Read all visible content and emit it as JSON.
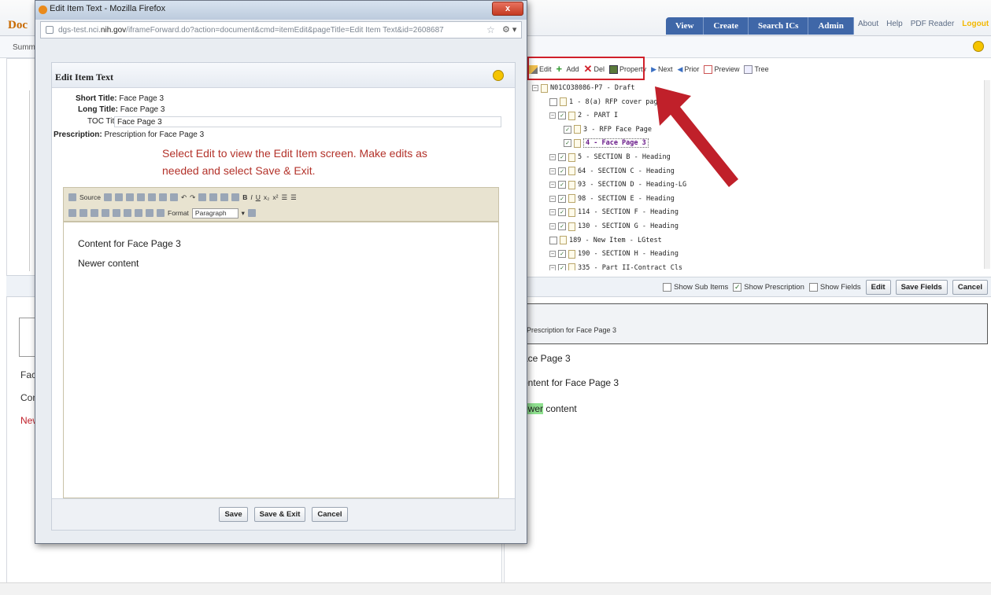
{
  "app": {
    "logo": "Doc",
    "nav_tabs": [
      "View",
      "Create",
      "Search ICs",
      "Admin"
    ],
    "nav_links": [
      "About",
      "Help",
      "PDF Reader"
    ],
    "logout": "Logout",
    "sub_summary": "Summ"
  },
  "right_toolbar": {
    "items": [
      "Edit",
      "Add",
      "Del",
      "Property",
      "Next",
      "Prior",
      "Preview",
      "Tree"
    ]
  },
  "tree": {
    "root": "N01CO38086-P7 - Draft",
    "items": [
      {
        "label": "1 - 8(a) RFP cover page",
        "checked": false,
        "expandable": false
      },
      {
        "label": "2 - PART I",
        "checked": true,
        "expandable": true
      },
      {
        "label": "3 - RFP Face Page",
        "checked": true,
        "expandable": false
      },
      {
        "label": "4 - Face Page 3",
        "checked": true,
        "expandable": false,
        "selected": true
      },
      {
        "label": "5 - SECTION B - Heading",
        "checked": true,
        "expandable": true
      },
      {
        "label": "64 - SECTION C - Heading",
        "checked": true,
        "expandable": true
      },
      {
        "label": "93 - SECTION D - Heading-LG",
        "checked": true,
        "expandable": true
      },
      {
        "label": "98 - SECTION E - Heading",
        "checked": true,
        "expandable": true
      },
      {
        "label": "114 - SECTION F - Heading",
        "checked": true,
        "expandable": true
      },
      {
        "label": "130 - SECTION G - Heading",
        "checked": true,
        "expandable": true
      },
      {
        "label": "189 - New Item - LGtest",
        "checked": false,
        "expandable": false
      },
      {
        "label": "190 - SECTION H - Heading",
        "checked": true,
        "expandable": true
      },
      {
        "label": "335 - Part II-Contract Cls",
        "checked": true,
        "expandable": true
      }
    ]
  },
  "options_bar": {
    "show_sub_items": "Show Sub Items",
    "show_prescription": "Show Prescription",
    "show_fields": "Show Fields",
    "edit": "Edit",
    "save_fields": "Save Fields",
    "cancel": "Cancel",
    "show_prescription_checked": true
  },
  "right_preview": {
    "prescription": "Prescription for Face Page 3",
    "title": "ace Page 3",
    "content": "ontent for Face Page 3",
    "newer_highlight": "ewer",
    "newer_rest": " content"
  },
  "left_preview": {
    "line1": "Fac",
    "line2": "Con",
    "line3": "New"
  },
  "modal": {
    "window_title": "Edit Item Text - Mozilla Firefox",
    "url_prefix": "dgs-test.nci.",
    "url_domain": "nih.gov",
    "url_rest": "/iframeForward.do?action=document&cmd=itemEdit&pageTitle=Edit Item Text&id=2608687",
    "heading": "Edit Item Text",
    "short_title_label": "Short Title:",
    "short_title_value": "Face Page 3",
    "long_title_label": "Long Title:",
    "long_title_value": "Face Page 3",
    "toc_title_label": "TOC Title:",
    "toc_title_value": "Face Page 3",
    "prescription_label": "Prescription:",
    "prescription_value": "Prescription for Face Page 3",
    "instruction": "Select Edit to view the Edit Item screen.  Make edits as needed and select Save & Exit.",
    "editor_toolbar": {
      "source": "Source",
      "format_label": "Format",
      "format_value": "Paragraph"
    },
    "editor_content": [
      "Content for Face Page 3",
      "Newer content"
    ],
    "buttons": {
      "save": "Save",
      "save_exit": "Save & Exit",
      "cancel": "Cancel"
    }
  },
  "colors": {
    "nav_blue": "#3f67a8",
    "annotation_red": "#c0202a",
    "instruction_red": "#b3322a",
    "highlight_green": "#8fe08f"
  }
}
